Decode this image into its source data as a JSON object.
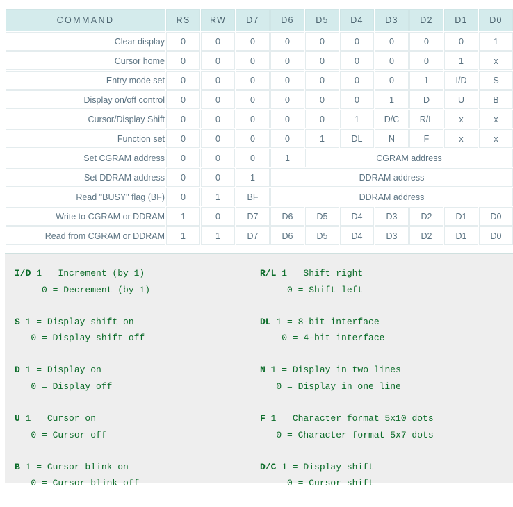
{
  "table": {
    "headers": [
      "COMMAND",
      "RS",
      "RW",
      "D7",
      "D6",
      "D5",
      "D4",
      "D3",
      "D2",
      "D1",
      "D0"
    ],
    "rows": [
      {
        "name": "Clear display",
        "cells": [
          "0",
          "0",
          "0",
          "0",
          "0",
          "0",
          "0",
          "0",
          "0",
          "1"
        ]
      },
      {
        "name": "Cursor home",
        "cells": [
          "0",
          "0",
          "0",
          "0",
          "0",
          "0",
          "0",
          "0",
          "1",
          "x"
        ]
      },
      {
        "name": "Entry mode set",
        "cells": [
          "0",
          "0",
          "0",
          "0",
          "0",
          "0",
          "0",
          "1",
          "I/D",
          "S"
        ]
      },
      {
        "name": "Display on/off control",
        "cells": [
          "0",
          "0",
          "0",
          "0",
          "0",
          "0",
          "1",
          "D",
          "U",
          "B"
        ]
      },
      {
        "name": "Cursor/Display Shift",
        "cells": [
          "0",
          "0",
          "0",
          "0",
          "0",
          "1",
          "D/C",
          "R/L",
          "x",
          "x"
        ]
      },
      {
        "name": "Function set",
        "cells": [
          "0",
          "0",
          "0",
          "0",
          "1",
          "DL",
          "N",
          "F",
          "x",
          "x"
        ]
      },
      {
        "name": "Set CGRAM address",
        "cells": [
          "0",
          "0",
          "0",
          "1"
        ],
        "span_label": "CGRAM address",
        "span": 6
      },
      {
        "name": "Set DDRAM address",
        "cells": [
          "0",
          "0",
          "1"
        ],
        "span_label": "DDRAM address",
        "span": 7
      },
      {
        "name": "Read \"BUSY\" flag (BF)",
        "cells": [
          "0",
          "1",
          "BF"
        ],
        "span_label": "DDRAM address",
        "span": 7
      },
      {
        "name": "Write to CGRAM or DDRAM",
        "cells": [
          "1",
          "0",
          "D7",
          "D6",
          "D5",
          "D4",
          "D3",
          "D2",
          "D1",
          "D0"
        ]
      },
      {
        "name": "Read from CGRAM or DDRAM",
        "cells": [
          "1",
          "1",
          "D7",
          "D6",
          "D5",
          "D4",
          "D3",
          "D2",
          "D1",
          "D0"
        ]
      }
    ]
  },
  "legend": {
    "left": [
      {
        "key": "I/D",
        "line1": " 1 = Increment (by 1)",
        "line2": "     0 = Decrement (by 1)"
      },
      {
        "key": "S",
        "line1": " 1 = Display shift on",
        "line2": "   0 = Display shift off"
      },
      {
        "key": "D",
        "line1": " 1 = Display on",
        "line2": "   0 = Display off"
      },
      {
        "key": "U",
        "line1": " 1 = Cursor on",
        "line2": "   0 = Cursor off"
      },
      {
        "key": "B",
        "line1": " 1 = Cursor blink on",
        "line2": "   0 = Cursor blink off"
      }
    ],
    "right": [
      {
        "key": "R/L",
        "line1": " 1 = Shift right",
        "line2": "     0 = Shift left"
      },
      {
        "key": "DL",
        "line1": " 1 = 8-bit interface",
        "line2": "    0 = 4-bit interface"
      },
      {
        "key": "N",
        "line1": " 1 = Display in two lines",
        "line2": "   0 = Display in one line"
      },
      {
        "key": "F",
        "line1": " 1 = Character format 5x10 dots",
        "line2": "   0 = Character format 5x7 dots"
      },
      {
        "key": "D/C",
        "line1": " 1 = Display shift",
        "line2": "     0 = Cursor shift"
      }
    ]
  },
  "colors": {
    "header_bg": "#d4ebec",
    "table_border": "#e4ecee",
    "cell_text": "#5b7382",
    "legend_bg": "#eeeeee",
    "legend_text": "#0a6b28",
    "legend_top_border": "#cfe0df"
  }
}
